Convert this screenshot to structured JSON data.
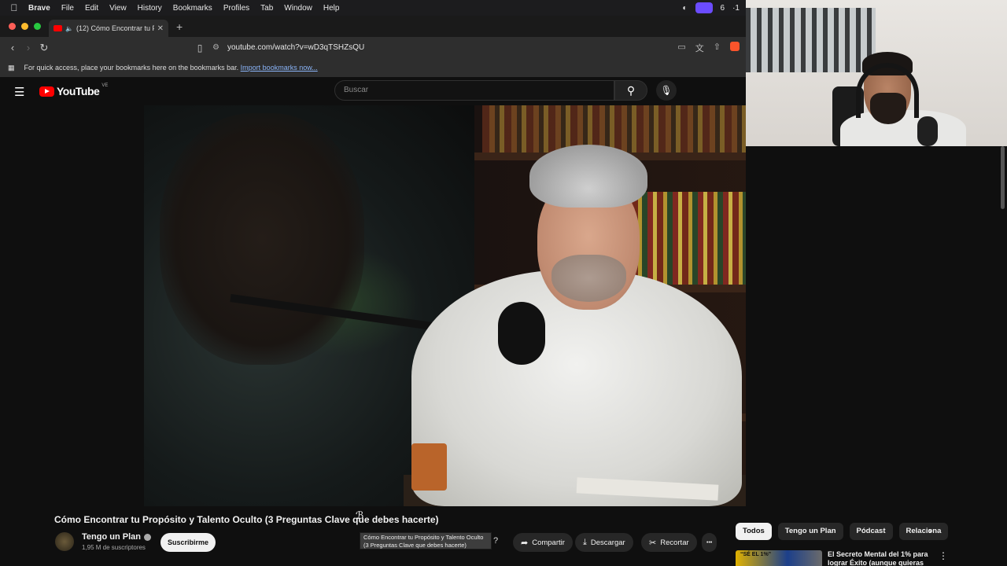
{
  "menubar": {
    "apple": "",
    "items": [
      "Brave",
      "File",
      "Edit",
      "View",
      "History",
      "Bookmarks",
      "Profiles",
      "Tab",
      "Window",
      "Help"
    ],
    "status_count": "6",
    "status_extra": "·1"
  },
  "browser": {
    "tab_title": "(12) Cómo Encontrar tu Pro",
    "url": "youtube.com/watch?v=wD3qTSHZsQU",
    "bookmarks_hint": "For quick access, place your bookmarks here on the bookmarks bar.",
    "import_link": "Import bookmarks now...",
    "colors": {
      "close": "#ff5f57",
      "min": "#febc2e",
      "max": "#28c840"
    }
  },
  "youtube": {
    "logo": "YouTube",
    "country": "VE",
    "search_placeholder": "Buscar"
  },
  "video": {
    "title": "Cómo Encontrar tu Propósito y Talento Oculto (3 Preguntas Clave que debes hacerte)",
    "tooltip": "Cómo Encontrar tu Propósito y Talento Oculto (3 Preguntas Clave que debes hacerte)",
    "tooltip_hidden_icon": "?"
  },
  "channel": {
    "name": "Tengo un Plan",
    "subscribers": "1,95 M de suscriptores",
    "subscribe_label": "Suscribirme"
  },
  "actions": {
    "share": "Compartir",
    "download": "Descargar",
    "clip": "Recortar",
    "more": "•••"
  },
  "chips": [
    "Todos",
    "Tengo un Plan",
    "Pódcast",
    "Relaciona"
  ],
  "recommendation": {
    "thumb_text": "“SÉ EL 1%”",
    "title": "El Secreto Mental del 1% para lograr Éxito (aunque quieras"
  }
}
